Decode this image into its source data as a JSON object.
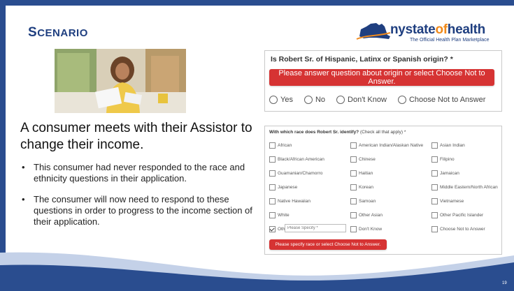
{
  "slide": {
    "title_cap": "S",
    "title_rest": "CENARIO",
    "page_number": "19",
    "colors": {
      "navy": "#1f3f80",
      "frame": "#2a4d8f",
      "accent_orange": "#f08a1c",
      "error_red": "#d63333",
      "wave_light": "#c4d1e8"
    }
  },
  "logo": {
    "name_part1": "nystate",
    "name_part2": "of",
    "name_part3": "health",
    "tagline": "The Official Health Plan Marketplace"
  },
  "headline": "A consumer meets with their Assistor to change their income.",
  "bullets": [
    "This consumer had never responded to the race and ethnicity questions in their application.",
    "The consumer will now need to respond to these questions in order to progress to the income section of their application."
  ],
  "origin_form": {
    "question": "Is Robert Sr. of Hispanic, Latinx or Spanish origin? *",
    "error_button": "Please answer question about origin or select Choose Not to Answer.",
    "options": [
      "Yes",
      "No",
      "Don't Know",
      "Choose Not to Answer"
    ]
  },
  "race_form": {
    "question_bold": "With which race does Robert Sr. identify?",
    "question_hint": " (Check all that apply) *",
    "options": [
      "African",
      "American Indian/Alaskan Native",
      "Asian Indian",
      "Black/African American",
      "Chinese",
      "Filipino",
      "Guamanian/Chamorro",
      "Haitian",
      "Jamaican",
      "Japanese",
      "Korean",
      "Middle Eastern/North African",
      "Native Hawaiian",
      "Samoan",
      "Vietnamese",
      "White",
      "Other Asian",
      "Other Pacific Islander",
      "Other",
      "Don't Know",
      "Choose Not to Answer"
    ],
    "checked_option": "Other",
    "specify_placeholder": "Please Specify *",
    "error_button": "Please specify race or select Choose Not to Answer."
  }
}
